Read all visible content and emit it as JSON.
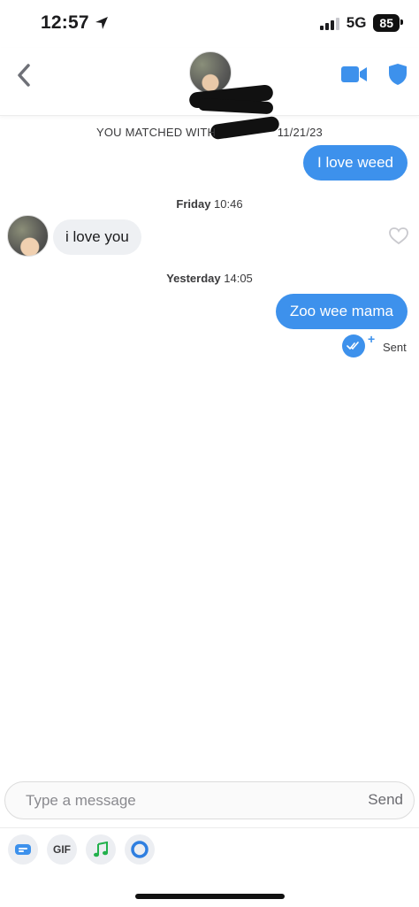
{
  "status_bar": {
    "time": "12:57",
    "network": "5G",
    "battery": "85"
  },
  "header": {
    "back_icon": "chevron-left-icon",
    "video_icon": "video-camera-icon",
    "safety_icon": "shield-icon",
    "accent": "#3d91ec"
  },
  "chat": {
    "matched_prefix": "YOU MATCHED WITH",
    "matched_date": "11/21/23",
    "messages": [
      {
        "direction": "out",
        "text": "I love weed"
      },
      {
        "stamp_day": "Friday",
        "stamp_time": "10:46"
      },
      {
        "direction": "in",
        "text": "i love you"
      },
      {
        "stamp_day": "Yesterday",
        "stamp_time": "14:05"
      },
      {
        "direction": "out",
        "text": "Zoo wee mama"
      }
    ],
    "status": "Sent"
  },
  "composer": {
    "placeholder": "Type a message",
    "send_label": "Send"
  },
  "toolbar": {
    "gif_label": "GIF",
    "tools": [
      "sticker-icon",
      "gif-icon",
      "music-note-icon",
      "ring-icon"
    ]
  }
}
